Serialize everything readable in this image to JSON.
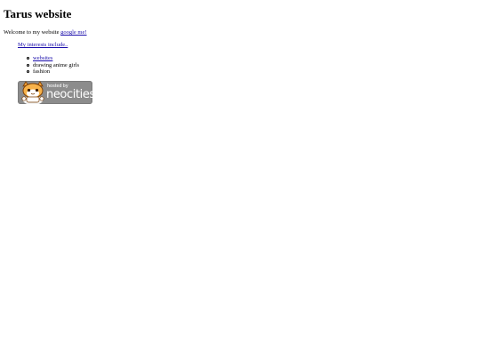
{
  "page": {
    "title": "Tarus website",
    "welcome_text": "Welcome to my website ",
    "welcome_link": "google me!",
    "interests_link": "My interests include.."
  },
  "interests": {
    "items": [
      "websites",
      "drawing anime girls",
      "fashion"
    ]
  },
  "badge": {
    "hosted_text": "hosted by",
    "brand_text": "neocities",
    "icon": "neocities-cat-mascot-icon"
  }
}
